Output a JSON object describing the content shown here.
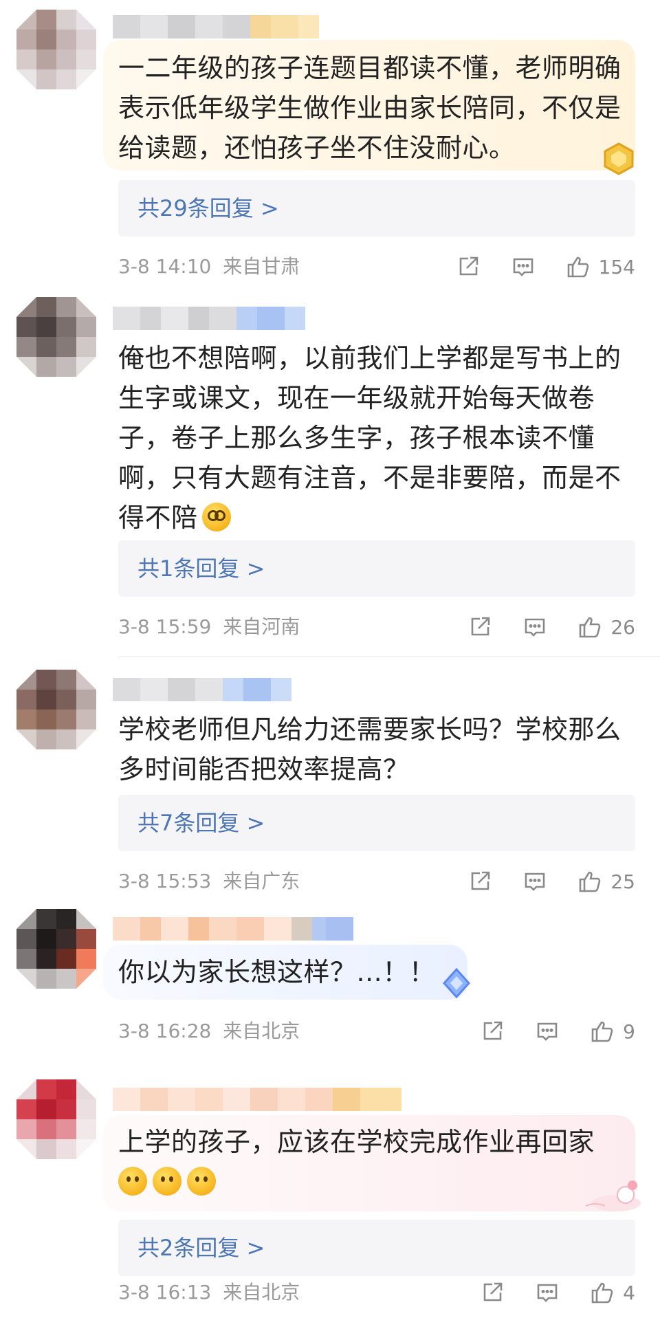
{
  "comments": [
    {
      "text": "一二年级的孩子连题目都读不懂，老师明确表示低年级学生做作业由家长陪同，不仅是给读题，还怕孩子坐不住没耐心。",
      "emojis": [],
      "reply_label": "共29条回复 >",
      "time": "3-8 14:10",
      "location": "来自甘肃",
      "likes": "154",
      "bubble_color": "#fff6e3",
      "badge": "gold-hex-badge-icon"
    },
    {
      "text": "俺也不想陪啊，以前我们上学都是写书上的生字或课文，现在一年级就开始每天做卷子，卷子上那么多生字，孩子根本读不懂啊，只有大题有注音，不是非要陪，而是不得不陪",
      "emojis": [
        "dizzy-face-emoji"
      ],
      "reply_label": "共1条回复 >",
      "time": "3-8 15:59",
      "location": "来自河南",
      "likes": "26",
      "bubble_color": "",
      "badge": ""
    },
    {
      "text": "学校老师但凡给力还需要家长吗？学校那么多时间能否把效率提高？",
      "emojis": [],
      "reply_label": "共7条回复 >",
      "time": "3-8 15:53",
      "location": "来自广东",
      "likes": "25",
      "bubble_color": "",
      "badge": ""
    },
    {
      "text": "你以为家长想这样？...！！",
      "emojis": [],
      "reply_label": "",
      "time": "3-8 16:28",
      "location": "来自北京",
      "likes": "9",
      "bubble_color": "#eef3ff",
      "badge": "blue-diamond-badge-icon"
    },
    {
      "text": "上学的孩子，应该在学校完成作业再回家",
      "emojis": [
        "smile-emoji",
        "smile-emoji",
        "smile-emoji"
      ],
      "reply_label": "共2条回复 >",
      "time": "3-8 16:13",
      "location": "来自北京",
      "likes": "4",
      "bubble_color": "#fdeef0",
      "badge": "pink-cat-sticker-icon"
    }
  ],
  "icons": {
    "share": "share-icon",
    "comment": "comment-icon",
    "like": "thumbs-up-icon"
  },
  "colors": {
    "link": "#4d76b4",
    "meta": "#9a9a9a",
    "reply_bg": "#f5f5f7"
  }
}
